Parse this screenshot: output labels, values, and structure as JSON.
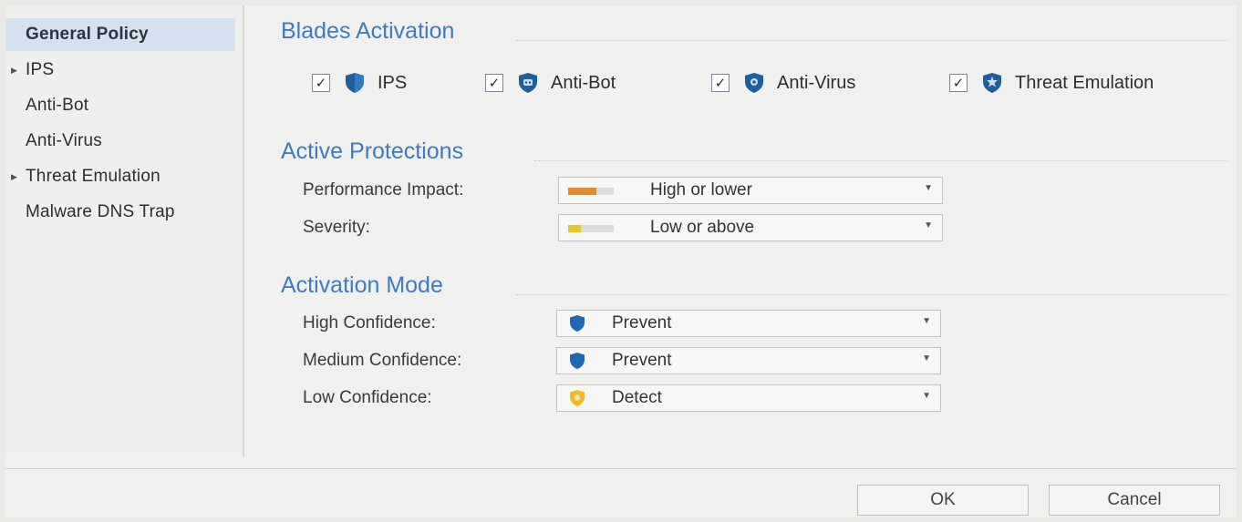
{
  "sidebar": {
    "items": [
      {
        "label": "General Policy",
        "selected": true,
        "expandable": false
      },
      {
        "label": "IPS",
        "selected": false,
        "expandable": true
      },
      {
        "label": "Anti-Bot",
        "selected": false,
        "expandable": false
      },
      {
        "label": "Anti-Virus",
        "selected": false,
        "expandable": false
      },
      {
        "label": "Threat Emulation",
        "selected": false,
        "expandable": true
      },
      {
        "label": "Malware DNS Trap",
        "selected": false,
        "expandable": false
      }
    ]
  },
  "blades_activation": {
    "title": "Blades Activation",
    "blades": [
      {
        "label": "IPS",
        "checked": true,
        "icon": "shield-icon"
      },
      {
        "label": "Anti-Bot",
        "checked": true,
        "icon": "bot-shield-icon"
      },
      {
        "label": "Anti-Virus",
        "checked": true,
        "icon": "virus-shield-icon"
      },
      {
        "label": "Threat Emulation",
        "checked": true,
        "icon": "threat-emulation-icon"
      }
    ]
  },
  "active_protections": {
    "title": "Active Protections",
    "performance_impact": {
      "label": "Performance Impact:",
      "value": "High or lower",
      "level_color": "#e8892a"
    },
    "severity": {
      "label": "Severity:",
      "value": "Low or above",
      "level_color": "#e8c72a"
    }
  },
  "activation_mode": {
    "title": "Activation Mode",
    "high": {
      "label": "High Confidence:",
      "value": "Prevent",
      "icon": "prevent-shield-icon"
    },
    "medium": {
      "label": "Medium Confidence:",
      "value": "Prevent",
      "icon": "prevent-shield-icon"
    },
    "low": {
      "label": "Low Confidence:",
      "value": "Detect",
      "icon": "detect-shield-icon"
    }
  },
  "footer": {
    "ok_label": "OK",
    "cancel_label": "Cancel"
  },
  "colors": {
    "accent_title": "#3d7cbf",
    "selected_bg": "#d4e1ef",
    "prevent_blue": "#1f68b3",
    "detect_yellow": "#f0b92a"
  }
}
